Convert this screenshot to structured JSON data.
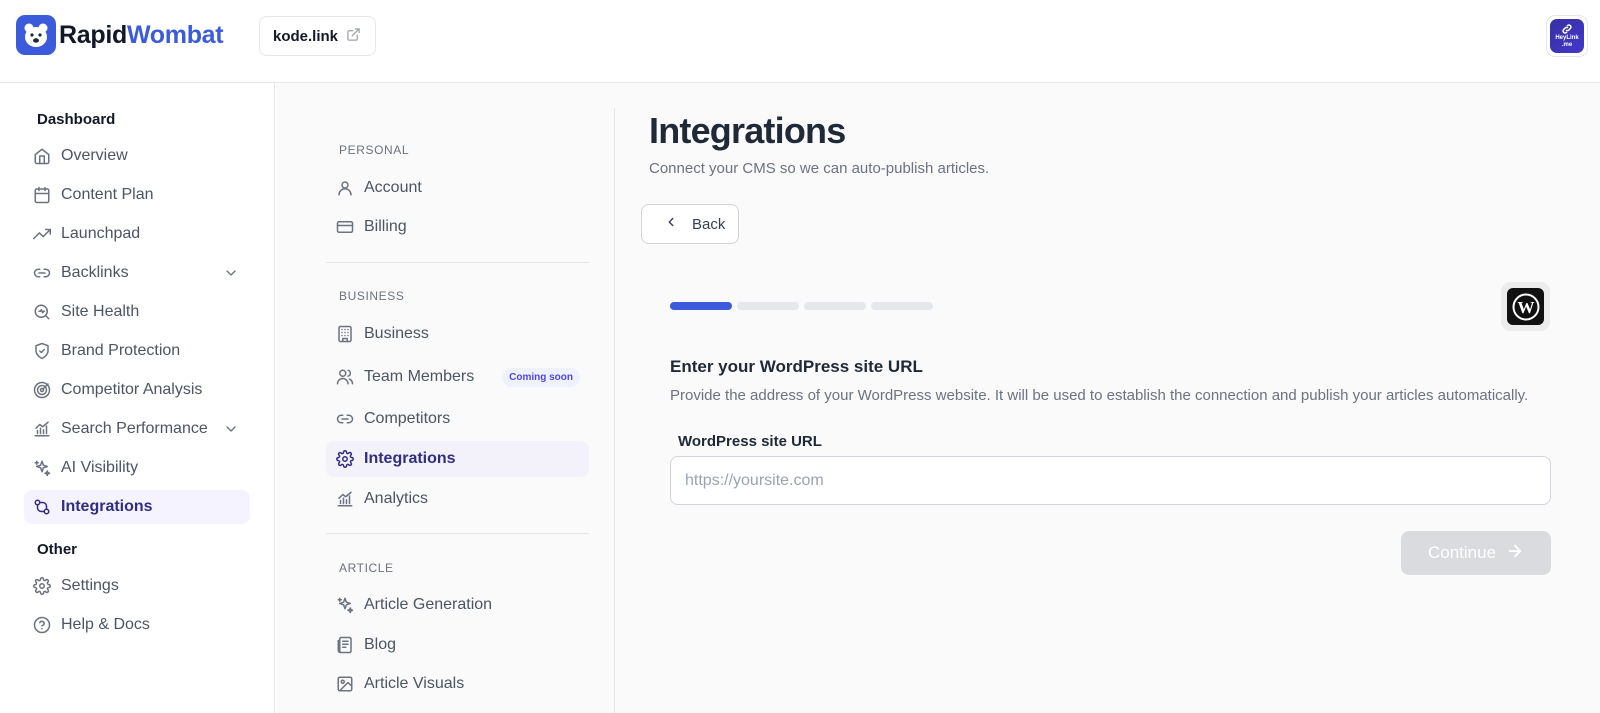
{
  "brand": {
    "name_part1": "Rapid",
    "name_part2": "Wombat",
    "accent": "#3b5bdb"
  },
  "header": {
    "site_chip": "kode.link",
    "avatar_line1": "HeyLink",
    "avatar_line2": ".me"
  },
  "sidebar": {
    "group_dashboard": "Dashboard",
    "group_other": "Other",
    "items": [
      {
        "label": "Overview",
        "icon": "home-icon"
      },
      {
        "label": "Content Plan",
        "icon": "calendar-icon"
      },
      {
        "label": "Launchpad",
        "icon": "trending-up-icon"
      },
      {
        "label": "Backlinks",
        "icon": "link-icon",
        "expandable": true
      },
      {
        "label": "Site Health",
        "icon": "search-health-icon"
      },
      {
        "label": "Brand Protection",
        "icon": "shield-icon"
      },
      {
        "label": "Competitor Analysis",
        "icon": "target-icon"
      },
      {
        "label": "Search Performance",
        "icon": "bar-chart-icon",
        "expandable": true
      },
      {
        "label": "AI Visibility",
        "icon": "sparkles-icon"
      },
      {
        "label": "Integrations",
        "icon": "integrations-icon",
        "active": true
      }
    ],
    "other_items": [
      {
        "label": "Settings",
        "icon": "gear-icon"
      },
      {
        "label": "Help & Docs",
        "icon": "help-circle-icon"
      }
    ]
  },
  "settings_nav": {
    "personal_label": "PERSONAL",
    "business_label": "BUSINESS",
    "article_label": "ARTICLE",
    "personal": [
      {
        "label": "Account",
        "icon": "user-icon"
      },
      {
        "label": "Billing",
        "icon": "credit-card-icon"
      }
    ],
    "business": [
      {
        "label": "Business",
        "icon": "building-icon"
      },
      {
        "label": "Team Members",
        "icon": "users-icon",
        "badge": "Coming soon"
      },
      {
        "label": "Competitors",
        "icon": "link-icon"
      },
      {
        "label": "Integrations",
        "icon": "gear-icon",
        "active": true
      },
      {
        "label": "Analytics",
        "icon": "bar-chart-icon"
      }
    ],
    "article": [
      {
        "label": "Article Generation",
        "icon": "sparkles-icon"
      },
      {
        "label": "Blog",
        "icon": "newspaper-icon"
      },
      {
        "label": "Article Visuals",
        "icon": "image-icon"
      }
    ]
  },
  "main": {
    "title": "Integrations",
    "subtitle": "Connect your CMS so we can auto-publish articles.",
    "back_label": "Back",
    "progress": {
      "current_step": 1,
      "total_steps": 4
    },
    "step_title": "Enter your WordPress site URL",
    "step_description": "Provide the address of your WordPress website. It will be used to establish the connection and publish your articles automatically.",
    "field_label": "WordPress site URL",
    "field_value": "",
    "field_placeholder": "https://yoursite.com",
    "continue_label": "Continue"
  }
}
